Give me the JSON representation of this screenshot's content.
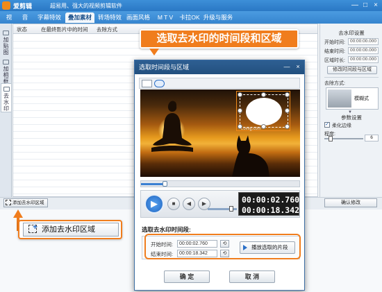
{
  "app": {
    "name": "爱剪辑",
    "slogan": "超易用、强大的视频剪辑软件",
    "min": "—",
    "max": "□",
    "close": "×"
  },
  "tabs": [
    "视 频",
    "音 频",
    "字幕特效",
    "叠加素材",
    "转场特效",
    "画面风格",
    "M T V",
    "卡拉OK",
    "升级与服务"
  ],
  "active_tab": "叠加素材",
  "left_tabs": [
    "加贴图",
    "加相框",
    "去水印"
  ],
  "table": {
    "columns": [
      "状态",
      "在最终影片中的时间",
      "去除方式"
    ]
  },
  "right_panel": {
    "section1_title": "去水印设置",
    "start_label": "开始时间:",
    "start_value": "00:00:00.000",
    "end_label": "结束时间:",
    "end_value": "00:00:00.000",
    "duration_label": "区域时长:",
    "duration_value": "00:00:00.000",
    "modify_button": "修改时间段与区域",
    "method_label": "去除方式:",
    "method_value": "模糊式",
    "section2_title": "参数设置",
    "soften_label": "柔化边缘",
    "degree_label": "程度:",
    "degree_value": "6",
    "confirm_button": "确认修改"
  },
  "bottom": {
    "add_button": "添加去水印区域"
  },
  "callout_top": "选取去水印的时间段和区域",
  "callout_add": "添加去水印区域",
  "dialog": {
    "title": "选取时间段与区域",
    "min": "—",
    "close": "×",
    "timecode_current": "00:00:02.760",
    "timecode_total": "00:00:18.342",
    "section_label": "选取去水印时间段:",
    "start_label": "开始时间:",
    "start_value": "00:00:02.760",
    "end_label": "结束时间:",
    "end_value": "00:00:18.342",
    "play_segment_button": "播放选取的片段",
    "ok_button": "确 定",
    "cancel_button": "取 消",
    "watermark_text": "Lovejj.com"
  },
  "colors": {
    "accent": "#f07d1d",
    "titlebar": "#2a78c4",
    "dialog_title": "#22507f"
  },
  "video_progress": 0.15,
  "volume_level": 0.8
}
